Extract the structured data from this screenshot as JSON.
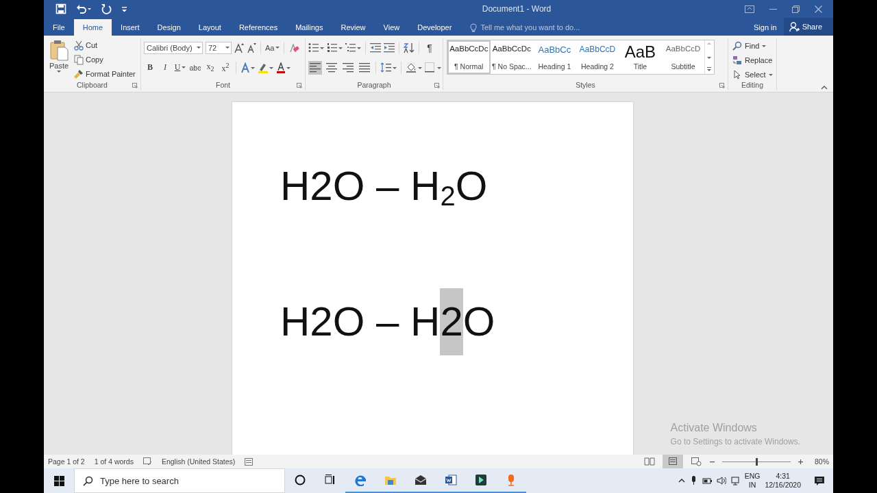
{
  "window": {
    "title": "Document1 - Word"
  },
  "tabs": [
    {
      "label": "File",
      "selected": false
    },
    {
      "label": "Home",
      "selected": true
    },
    {
      "label": "Insert",
      "selected": false
    },
    {
      "label": "Design",
      "selected": false
    },
    {
      "label": "Layout",
      "selected": false
    },
    {
      "label": "References",
      "selected": false
    },
    {
      "label": "Mailings",
      "selected": false
    },
    {
      "label": "Review",
      "selected": false
    },
    {
      "label": "View",
      "selected": false
    },
    {
      "label": "Developer",
      "selected": false
    }
  ],
  "tell_me": {
    "placeholder": "Tell me what you want to do..."
  },
  "account": {
    "sign_in": "Sign in",
    "share": "Share"
  },
  "ribbon": {
    "clipboard": {
      "label": "Clipboard",
      "paste": "Paste",
      "cut": "Cut",
      "copy": "Copy",
      "format_painter": "Format Painter"
    },
    "font": {
      "label": "Font",
      "font_name": "Calibri (Body)",
      "font_size": "72",
      "change_case": "Aa",
      "format_buttons": [
        {
          "kind": "bold",
          "label": "B"
        },
        {
          "kind": "italic",
          "label": "I"
        },
        {
          "kind": "underline",
          "label": "U"
        },
        {
          "kind": "strike",
          "label": "abc"
        },
        {
          "kind": "subscript",
          "label": "x$_{2}$"
        },
        {
          "kind": "superscript",
          "label": "x$^{2}$"
        }
      ]
    },
    "paragraph": {
      "label": "Paragraph",
      "show_marks": "¶",
      "alignments": [
        {
          "kind": "left",
          "selected": true
        },
        {
          "kind": "center",
          "selected": false
        },
        {
          "kind": "right",
          "selected": false
        },
        {
          "kind": "justify",
          "selected": false
        }
      ]
    },
    "styles": {
      "label": "Styles",
      "items": [
        {
          "kind": "normal",
          "preview": "AaBbCcDc",
          "name": "¶ Normal",
          "selected": true
        },
        {
          "kind": "normal",
          "preview": "AaBbCcDc",
          "name": "¶ No Spac...",
          "selected": false
        },
        {
          "kind": "heading1",
          "preview": "AaBbCc",
          "name": "Heading 1",
          "selected": false
        },
        {
          "kind": "heading2",
          "preview": "AaBbCcD",
          "name": "Heading 2",
          "selected": false
        },
        {
          "kind": "title",
          "preview": "AaB",
          "name": "Title",
          "selected": false
        },
        {
          "kind": "subtitle",
          "preview": "AaBbCcD",
          "name": "Subtitle",
          "selected": false
        }
      ]
    },
    "editing": {
      "label": "Editing",
      "find": "Find",
      "replace": "Replace",
      "select": "Select"
    }
  },
  "document": {
    "paragraphs": [
      {
        "runs": [
          {
            "text": "H2O – H",
            "subscript": false,
            "selected": false
          },
          {
            "text": "2",
            "subscript": true,
            "selected": false
          },
          {
            "text": "O",
            "subscript": false,
            "selected": false
          }
        ]
      },
      {
        "runs": [
          {
            "text": "H2O – H",
            "subscript": false,
            "selected": false
          },
          {
            "text": "2",
            "subscript": false,
            "selected": true
          },
          {
            "text": "O",
            "subscript": false,
            "selected": false
          }
        ]
      }
    ]
  },
  "activation_notice": {
    "title": "Activate Windows",
    "message": "Go to Settings to activate Windows."
  },
  "status_bar": {
    "page": "Page 1 of 2",
    "words": "1 of 4 words",
    "language": "English (United States)",
    "views": [
      {
        "kind": "read",
        "selected": false
      },
      {
        "kind": "print",
        "selected": true
      },
      {
        "kind": "web",
        "selected": false
      }
    ],
    "zoom": {
      "level": 0.5,
      "reading": "80%"
    }
  },
  "taskbar": {
    "search": {
      "placeholder": "Type here to search"
    },
    "apps": [
      {
        "kind": "cortana",
        "running": false
      },
      {
        "kind": "taskview",
        "running": false
      },
      {
        "kind": "edge",
        "running": true
      },
      {
        "kind": "explorer",
        "running": true
      },
      {
        "kind": "mail",
        "running": true
      },
      {
        "kind": "word",
        "running": true
      },
      {
        "kind": "editor",
        "running": true
      },
      {
        "kind": "recorder",
        "running": true
      }
    ],
    "language": "ENG",
    "region": "IN",
    "time": "4:31",
    "date": "12/16/2020"
  }
}
